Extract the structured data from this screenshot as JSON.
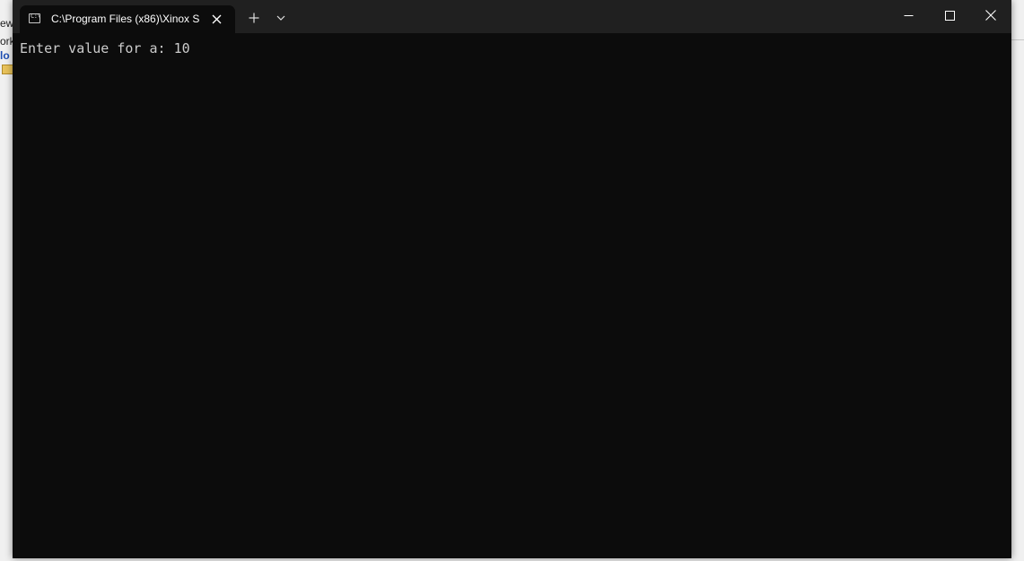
{
  "background": {
    "snippets": [
      "ew",
      "ork",
      "lo"
    ]
  },
  "window": {
    "tab": {
      "title": "C:\\Program Files (x86)\\Xinox S",
      "icon": "console-icon",
      "icon_glyph": "C:\\"
    },
    "controls": {
      "new_tab": "plus-icon",
      "dropdown": "chevron-down-icon",
      "minimize": "minimize-icon",
      "maximize": "maximize-icon",
      "close": "close-icon"
    }
  },
  "terminal": {
    "lines": [
      "Enter value for a: 10"
    ],
    "background": "#0c0c0c",
    "foreground": "#cccccc"
  }
}
